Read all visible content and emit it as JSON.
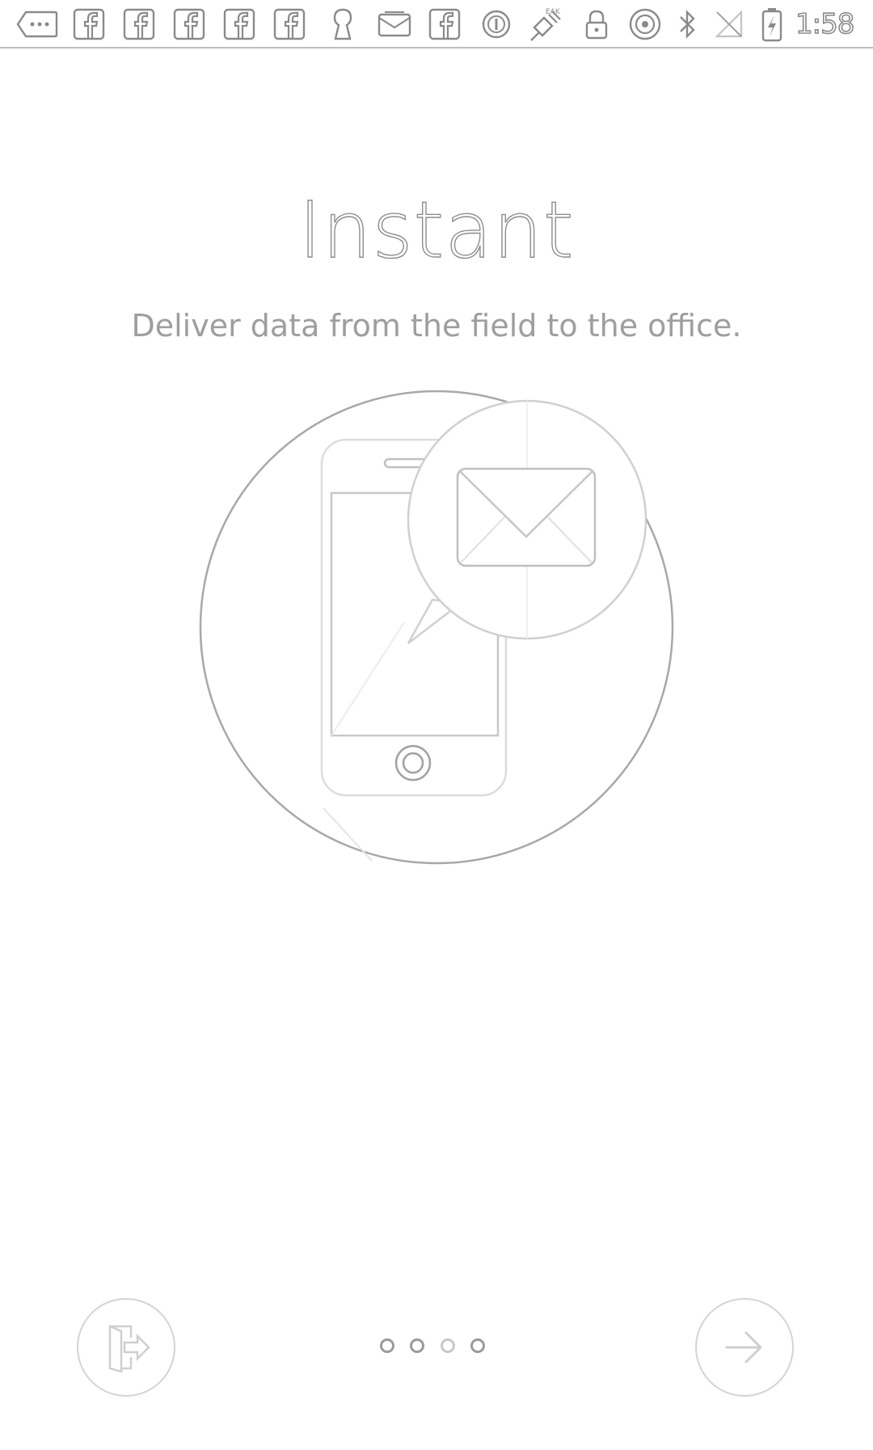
{
  "status_bar": {
    "time": "1:58",
    "notification_icons": [
      "more-dots-icon",
      "facebook-icon",
      "facebook-icon",
      "facebook-icon",
      "facebook-icon",
      "facebook-icon",
      "keyhole-icon",
      "inbox-icon",
      "facebook-icon",
      "circle-badge-icon",
      "satellite-icon",
      "lock-icon",
      "hotspot-icon",
      "bluetooth-icon",
      "no-signal-icon",
      "battery-charging-icon"
    ]
  },
  "onboarding": {
    "title": "Instant",
    "subtitle": "Deliver data from the field to the office.",
    "illustration_icons": [
      "phone-icon",
      "mail-icon"
    ],
    "page_count": 4,
    "current_page": 1
  },
  "buttons": {
    "skip_icon": "exit-door-icon",
    "next_icon": "arrow-right-icon"
  },
  "colors": {
    "background": "#ffffff",
    "line_gray": "#9e9e9e",
    "light_gray": "#d4d4d4"
  }
}
